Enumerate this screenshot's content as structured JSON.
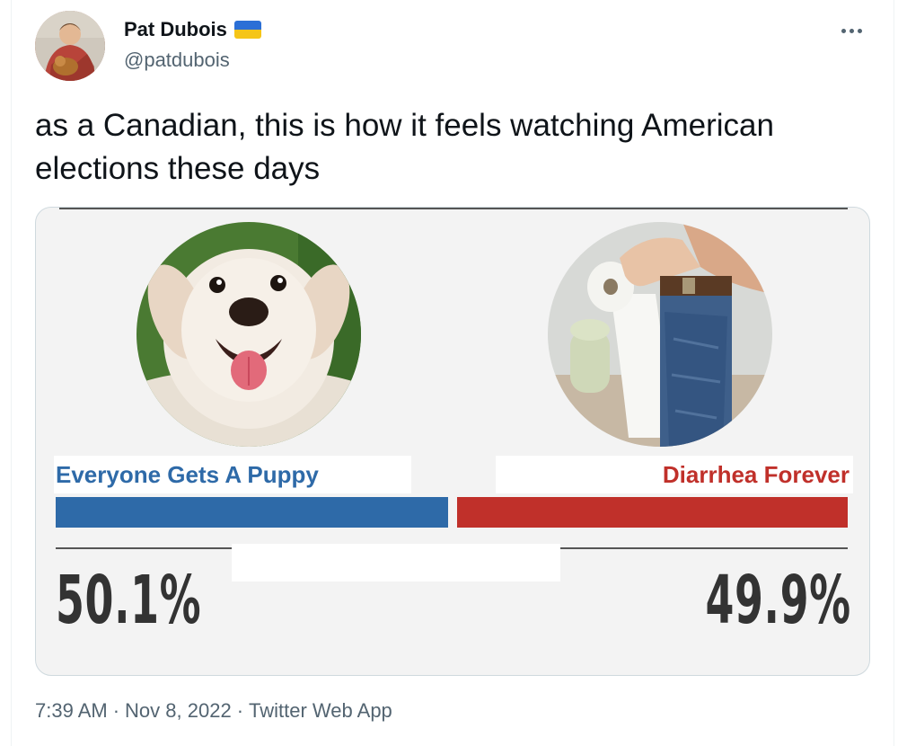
{
  "author": {
    "display_name": "Pat Dubois",
    "handle": "@patdubois",
    "flag_colors": {
      "top": "#2b6fd6",
      "bottom": "#f5c518"
    }
  },
  "more_icon": "ellipsis-icon",
  "tweet_text": "as a Canadian, this is how it feels watching American elections these days",
  "media": {
    "left_option": {
      "label": "Everyone Gets A Puppy",
      "percent_text": "50.1%",
      "percent": 50.1,
      "color": "#2e6aa8",
      "image": "puppy"
    },
    "right_option": {
      "label": "Diarrhea Forever",
      "percent_text": "49.9%",
      "percent": 49.9,
      "color": "#c0302a",
      "image": "toilet"
    }
  },
  "meta": {
    "time": "7:39 AM",
    "separator": "·",
    "date": "Nov 8, 2022",
    "source": "Twitter Web App"
  }
}
